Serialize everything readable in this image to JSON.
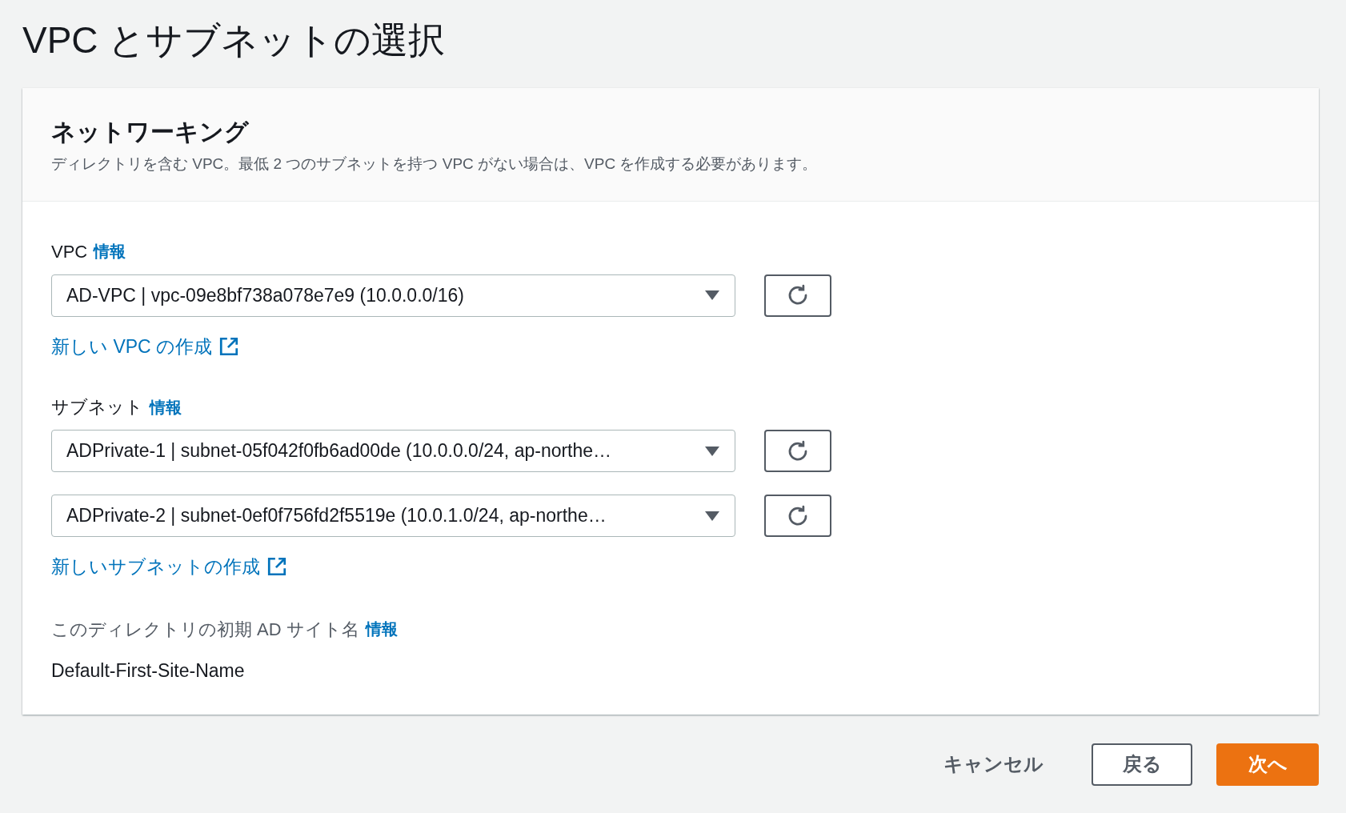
{
  "page_title": "VPC とサブネットの選択",
  "panel": {
    "title": "ネットワーキング",
    "description": "ディレクトリを含む VPC。最低 2 つのサブネットを持つ VPC がない場合は、VPC を作成する必要があります。"
  },
  "vpc": {
    "label": "VPC",
    "info": "情報",
    "selects": [
      {
        "value": "AD-VPC | vpc-09e8bf738a078e7e9 (10.0.0.0/16)"
      }
    ],
    "create_link": "新しい VPC の作成"
  },
  "subnets": {
    "label": "サブネット",
    "info": "情報",
    "selects": [
      {
        "value": "ADPrivate-1 | subnet-05f042f0fb6ad00de (10.0.0.0/24, ap-northe…"
      },
      {
        "value": "ADPrivate-2 | subnet-0ef0f756fd2f5519e (10.0.1.0/24, ap-northe…"
      }
    ],
    "create_link": "新しいサブネットの作成"
  },
  "site_name": {
    "label": "このディレクトリの初期 AD サイト名",
    "info": "情報",
    "value": "Default-First-Site-Name"
  },
  "footer": {
    "cancel": "キャンセル",
    "back": "戻る",
    "next": "次へ"
  }
}
